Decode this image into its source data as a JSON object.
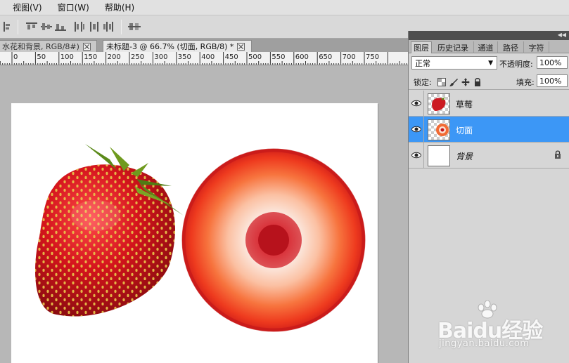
{
  "menu": {
    "items": [
      "视图(V)",
      "窗口(W)",
      "帮助(H)"
    ]
  },
  "toolbar": {
    "icons": [
      "align-top-icon",
      "align-vcenter-icon",
      "align-bottom-icon",
      "align-left-icon",
      "align-hcenter-icon",
      "align-right-icon",
      "distribute-icon",
      "auto-align-icon"
    ]
  },
  "doc_tabs": [
    {
      "label": "水花和背景, RGB/8#)",
      "active": false
    },
    {
      "label": "未标题-3 @ 66.7% (切面, RGB/8) *",
      "active": true
    }
  ],
  "ruler": {
    "labels": [
      "0",
      "50",
      "100",
      "150",
      "200",
      "250",
      "300",
      "350",
      "400",
      "450",
      "500",
      "550",
      "600",
      "650",
      "700",
      "750"
    ]
  },
  "panel": {
    "tabs": [
      "图层",
      "历史记录",
      "通道",
      "路径",
      "字符"
    ],
    "active_tab": "图层",
    "blend_mode": "正常",
    "opacity_label": "不透明度:",
    "opacity_value": "100%",
    "lock_label": "锁定:",
    "fill_label": "填充:",
    "fill_value": "100%",
    "layers": [
      {
        "name": "草莓",
        "selected": false,
        "locked": false
      },
      {
        "name": "切面",
        "selected": true,
        "locked": false
      },
      {
        "name": "背景",
        "selected": false,
        "locked": true
      }
    ]
  },
  "watermark": {
    "brand": "Baidu经验",
    "url": "jingyan.baidu.com"
  },
  "colors": {
    "selection": "#3c97f6",
    "strawberry_red": "#c8141c",
    "leaf_green": "#6f9a1e"
  }
}
